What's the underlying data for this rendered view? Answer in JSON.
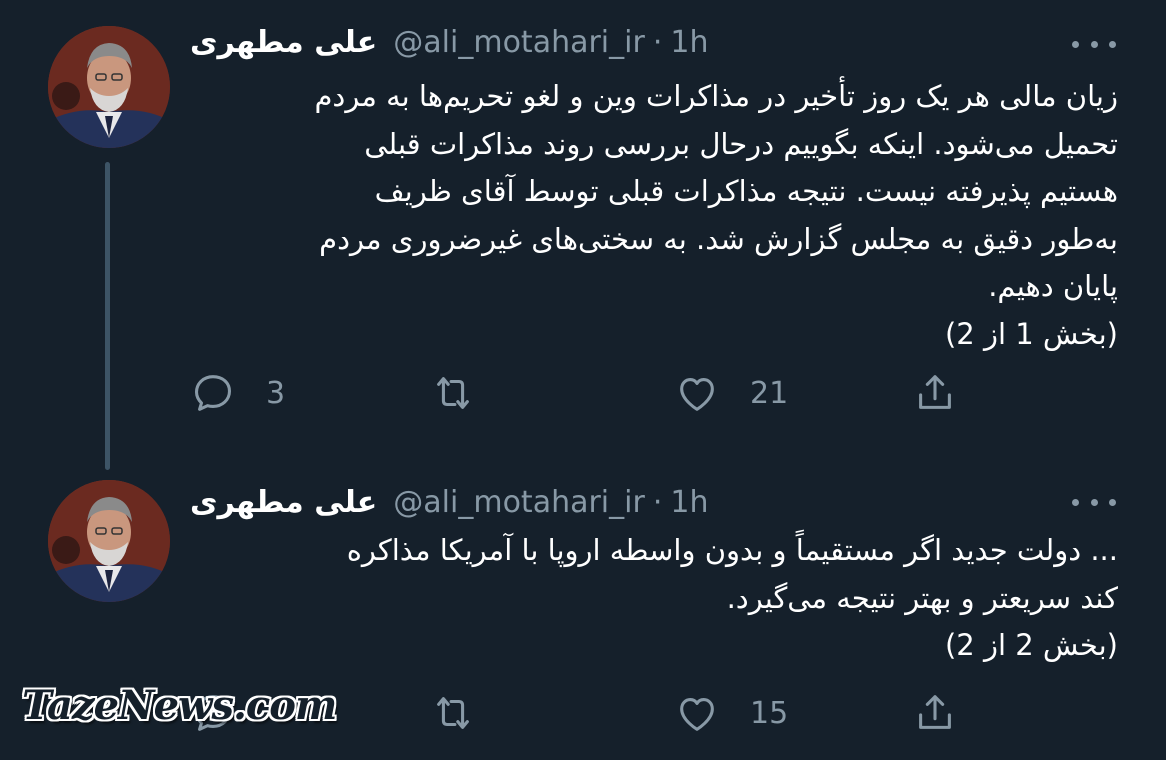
{
  "tweets": [
    {
      "display_name": "علی مطهری",
      "handle": "@ali_motahari_ir",
      "separator": "·",
      "time": "1h",
      "lines": [
        "زیان مالی هر یک روز تأخیر در مذاکرات وین و لغو تحریم‌ها به مردم",
        "تحمیل می‌شود. اینکه بگوییم درحال بررسی روند مذاکرات قبلی",
        "هستیم پذیرفته نیست. نتیجه مذاکرات قبلی توسط آقای ظریف",
        "به‌طور دقیق به مجلس گزارش شد. به سختی‌های غیرضروری مردم",
        "پایان دهیم.",
        "(بخش 1 از 2)"
      ],
      "reply_count": "3",
      "retweet_count": "",
      "like_count": "21",
      "icons": {
        "reply": "reply-icon",
        "retweet": "retweet-icon",
        "like": "heart-icon",
        "share": "share-icon",
        "more": "more-icon"
      }
    },
    {
      "display_name": "علی مطهری",
      "handle": "@ali_motahari_ir",
      "separator": "·",
      "time": "1h",
      "lines": [
        "... دولت جدید اگر  مستقیماً و بدون واسطه اروپا با آمریکا مذاکره",
        "کند سریعتر و بهتر نتیجه می‌گیرد.",
        "(بخش 2 از 2)"
      ],
      "reply_count": "",
      "retweet_count": "",
      "like_count": "15",
      "icons": {
        "reply": "reply-icon",
        "retweet": "retweet-icon",
        "like": "heart-icon",
        "share": "share-icon",
        "more": "more-icon"
      }
    }
  ],
  "watermark": "TazeNews.com",
  "colors": {
    "background": "#15202b",
    "text": "#ffffff",
    "secondary": "#8899a6",
    "thread_line": "#3d5466"
  }
}
